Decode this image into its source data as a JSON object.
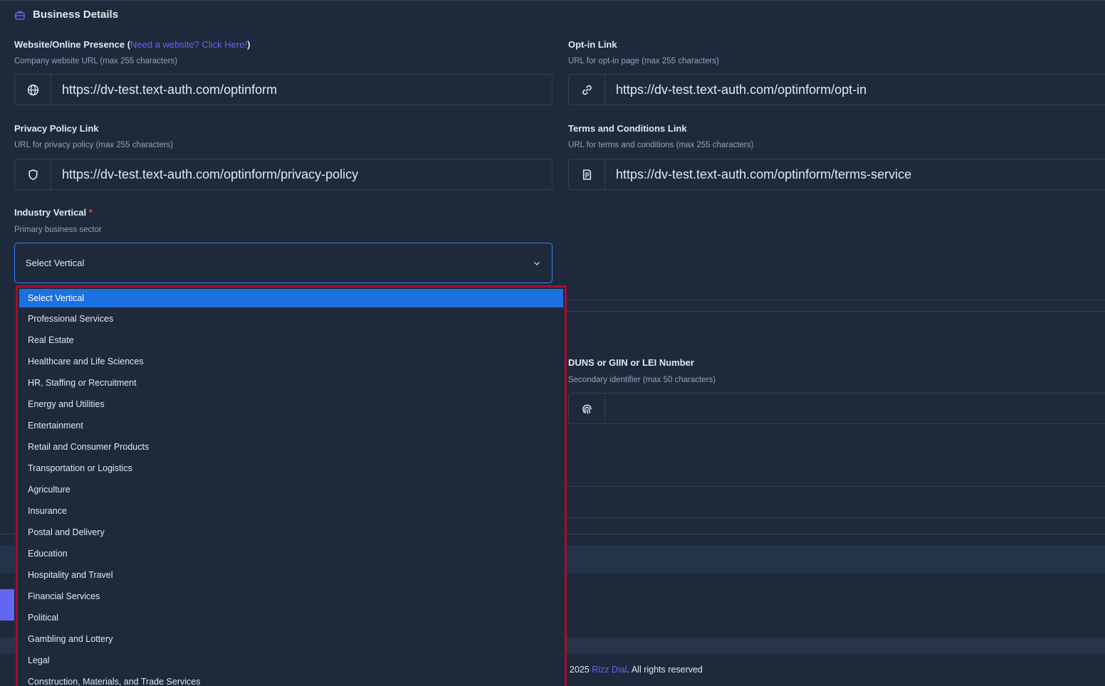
{
  "section": {
    "title": "Business Details"
  },
  "website": {
    "label": "Website/Online Presence (",
    "link_text": "Need a website? Click Here!",
    "label_suffix": ")",
    "hint": "Company website URL (max 255 characters)",
    "value": "https://dv-test.text-auth.com/optinform",
    "icon": "globe-icon"
  },
  "optin": {
    "label": "Opt-in Link",
    "hint": "URL for opt-in page (max 255 characters)",
    "value": "https://dv-test.text-auth.com/optinform/opt-in",
    "icon": "link-icon"
  },
  "privacy": {
    "label": "Privacy Policy Link",
    "hint": "URL for privacy policy (max 255 characters)",
    "value": "https://dv-test.text-auth.com/optinform/privacy-policy",
    "icon": "shield-icon"
  },
  "terms": {
    "label": "Terms and Conditions Link",
    "hint": "URL for terms and conditions (max 255 characters)",
    "value": "https://dv-test.text-auth.com/optinform/terms-service",
    "icon": "document-icon"
  },
  "industry": {
    "label": "Industry Vertical",
    "required_mark": "*",
    "hint": "Primary business sector",
    "selected": "Select Vertical",
    "options": [
      "Select Vertical",
      "Professional Services",
      "Real Estate",
      "Healthcare and Life Sciences",
      "HR, Staffing or Recruitment",
      "Energy and Utilities",
      "Entertainment",
      "Retail and Consumer Products",
      "Transportation or Logistics",
      "Agriculture",
      "Insurance",
      "Postal and Delivery",
      "Education",
      "Hospitality and Travel",
      "Financial Services",
      "Political",
      "Gambling and Lottery",
      "Legal",
      "Construction, Materials, and Trade Services"
    ]
  },
  "duns": {
    "label": "DUNS or GIIN or LEI Number",
    "hint": "Secondary identifier (max 50 characters)",
    "value": "",
    "icon": "fingerprint-icon"
  },
  "footer": {
    "prefix": "2025 ",
    "brand": "Rizz Dial",
    "suffix": ". All rights reserved"
  },
  "colors": {
    "background": "#1e293b",
    "accent": "#6366f1",
    "selected_option": "#1d70e0",
    "dropdown_border": "#a1102f",
    "required": "#ef4444"
  }
}
